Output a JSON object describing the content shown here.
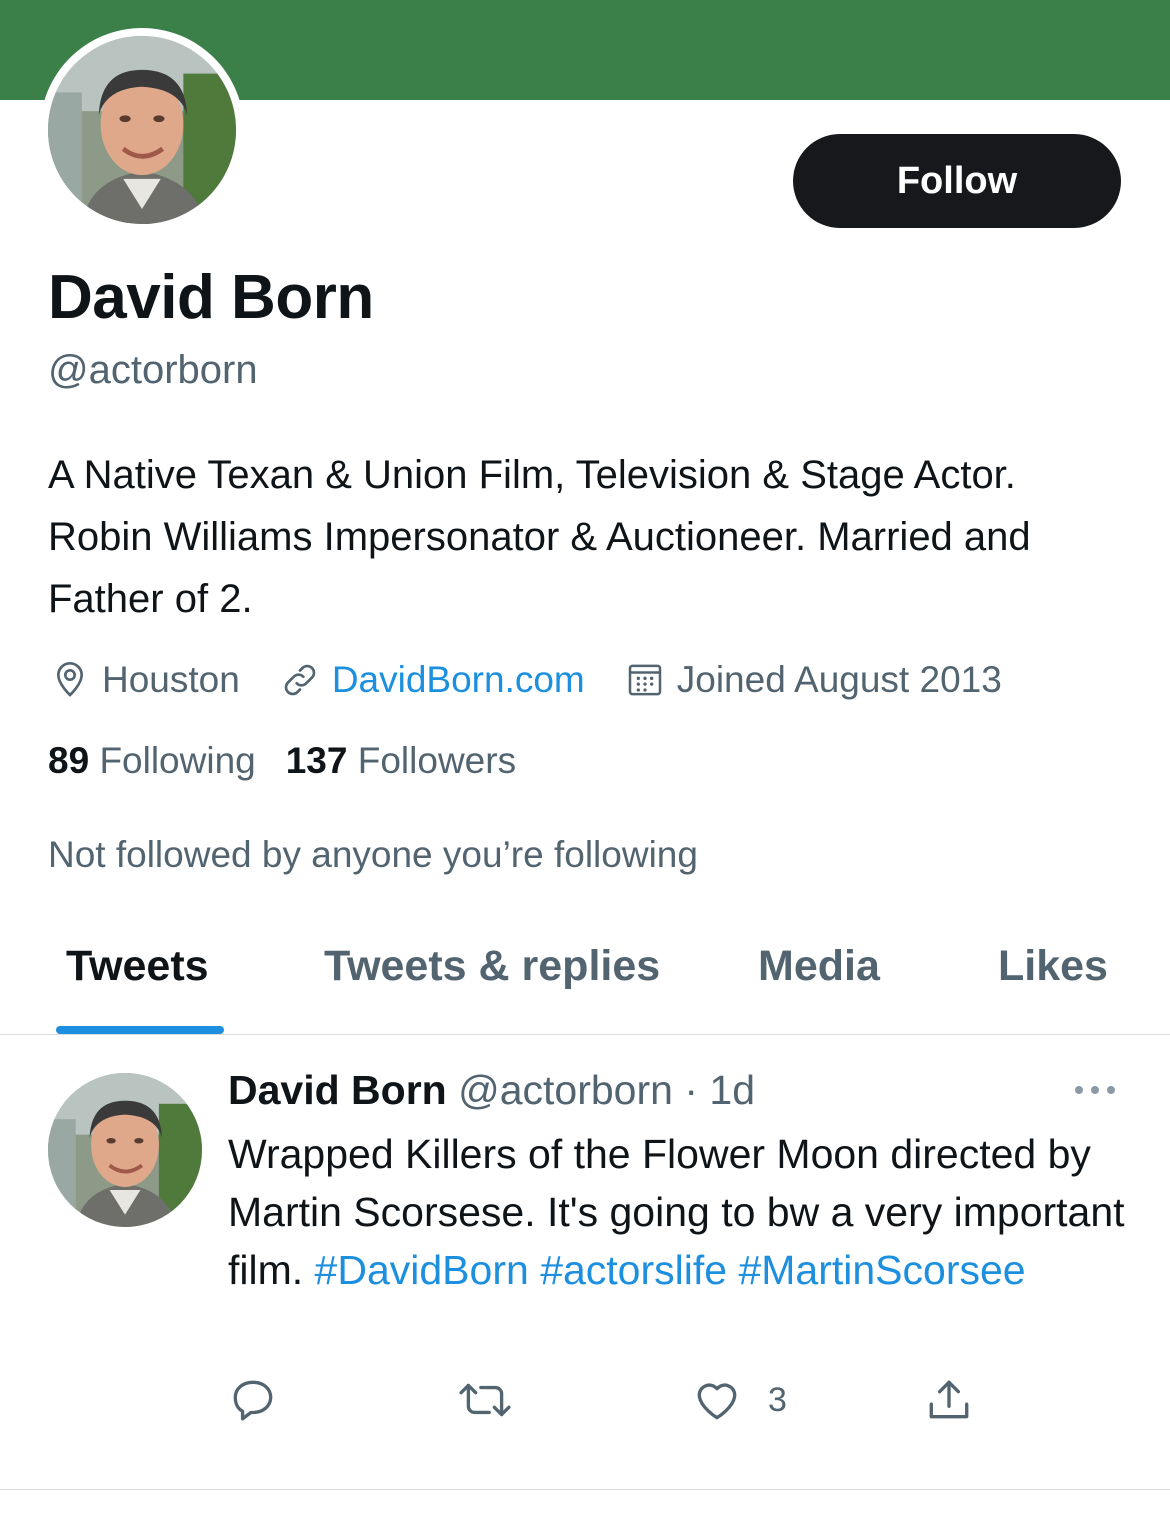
{
  "profile": {
    "name": "David Born",
    "handle": "@actorborn",
    "bio": "A Native Texan & Union Film, Television & Stage Actor. Robin Williams Impersonator & Auctioneer. Married and Father of 2.",
    "location": "Houston",
    "website": "DavidBorn.com",
    "joined": "Joined August 2013",
    "following_count": "89",
    "following_label": "Following",
    "followers_count": "137",
    "followers_label": "Followers",
    "not_followed_text": "Not followed by anyone you’re following",
    "follow_label": "Follow",
    "banner_color": "#3a8048",
    "link_color": "#1d8fdf"
  },
  "icons": {
    "location": "location-pin-icon",
    "link": "link-icon",
    "calendar": "calendar-icon",
    "more": "more-icon",
    "reply": "reply-icon",
    "retweet": "retweet-icon",
    "like": "heart-icon",
    "share": "share-icon"
  },
  "tabs": [
    {
      "label": "Tweets",
      "active": true
    },
    {
      "label": "Tweets & replies",
      "active": false
    },
    {
      "label": "Media",
      "active": false
    },
    {
      "label": "Likes",
      "active": false
    }
  ],
  "tweet": {
    "author_name": "David Born",
    "author_handle": "@actorborn",
    "separator": "·",
    "time": "1d",
    "text": "Wrapped Killers of the Flower Moon directed by Martin Scorsese. It's going to bw a very important film. ",
    "hashtags": [
      "#DavidBorn",
      "#actorslife",
      "#MartinScorsee"
    ],
    "like_count": "3"
  }
}
